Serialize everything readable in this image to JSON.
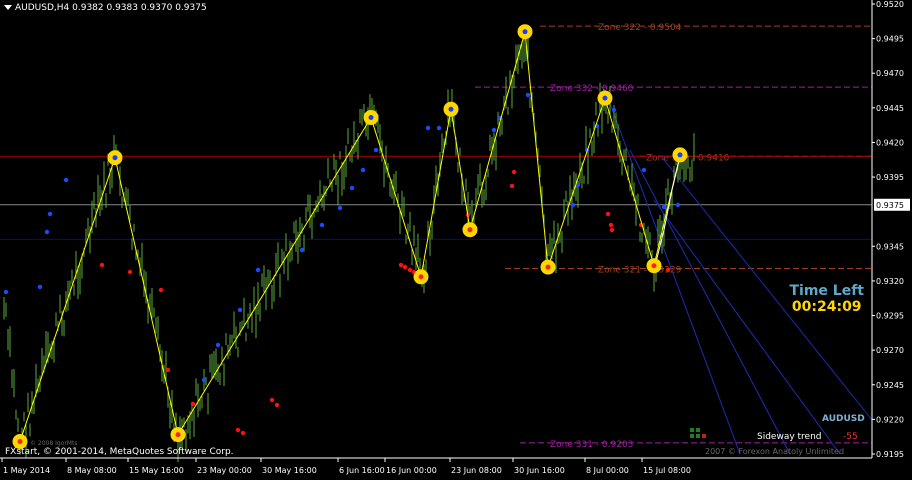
{
  "header": {
    "symbol_timeframe": "AUDUSD,H4",
    "ohlc": "0.9382 0.9383 0.9370 0.9375"
  },
  "current_price_label": "0.9375",
  "time_left": {
    "title": "Time Left",
    "value": "00:24:09"
  },
  "copyright": "FXstart, © 2001-2014, MetaQuotes Software Corp.",
  "small_logo": "© 2008 IgorMts",
  "symbol_badge": "AUDUSD",
  "trend_label": "Sideway trend",
  "trend_value": "-55",
  "footer_credit": "2007 © Forexon Anatoly Unlimited",
  "colors": {
    "candle": "#5aaa3a",
    "zigzag": "#ffff00",
    "marker": "#ffd700",
    "red_line": "#b00000",
    "blue_line": "#0000d0",
    "zone_brown": "#a04020",
    "zone_purple": "#a020a0",
    "dot_blue": "#1a4cff",
    "dot_red": "#ff1010"
  },
  "chart_data": {
    "type": "candlestick",
    "title": "AUDUSD,H4",
    "ylim": [
      0.9195,
      0.952
    ],
    "y_ticks": [
      "0.9520",
      "0.9495",
      "0.9470",
      "0.9445",
      "0.9420",
      "0.9395",
      "0.9375",
      "0.9345",
      "0.9320",
      "0.9295",
      "0.9270",
      "0.9245",
      "0.9220",
      "0.9195"
    ],
    "x_ticks": [
      "1 May 2014",
      "8 May 08:00",
      "15 May 16:00",
      "23 May 00:00",
      "30 May 16:00",
      "6 Jun 16:00",
      "16 Jun 00:00",
      "23 Jun 08:00",
      "30 Jun 16:00",
      "8 Jul 00:00",
      "15 Jul 08:00"
    ],
    "zigzag": [
      {
        "x": "1 May 2014",
        "y": 0.9204
      },
      {
        "x": "8 May",
        "y": 0.9409
      },
      {
        "x": "15 May",
        "y": 0.9209
      },
      {
        "x": "30 May",
        "y": 0.9438
      },
      {
        "x": "6 Jun",
        "y": 0.9323
      },
      {
        "x": "11 Jun",
        "y": 0.9444
      },
      {
        "x": "16 Jun",
        "y": 0.9357
      },
      {
        "x": "23 Jun",
        "y": 0.95
      },
      {
        "x": "30 Jun",
        "y": 0.933
      },
      {
        "x": "3 Jul",
        "y": 0.9452
      },
      {
        "x": "8 Jul",
        "y": 0.9331
      },
      {
        "x": "15 Jul",
        "y": 0.9411
      }
    ],
    "horizontal_lines": [
      {
        "name": "resistance",
        "y": 0.941,
        "color": "red"
      },
      {
        "name": "support",
        "y": 0.935,
        "color": "blue"
      },
      {
        "name": "current",
        "y": 0.9375,
        "color": "gray"
      }
    ],
    "zones": [
      {
        "label": "Zone 322 - 0.9504",
        "y": 0.9504,
        "color": "brown"
      },
      {
        "label": "Zone 332 - 0.9460",
        "y": 0.946,
        "color": "purple"
      },
      {
        "label": "Zone 312 - 0.9410",
        "y": 0.941,
        "color": "brown"
      },
      {
        "label": "Zone 321 - 0.9329",
        "y": 0.9329,
        "color": "brown"
      },
      {
        "label": "Zone 331 - 0.9203",
        "y": 0.9203,
        "color": "purple"
      }
    ],
    "channel_lines": true,
    "grid": false
  }
}
